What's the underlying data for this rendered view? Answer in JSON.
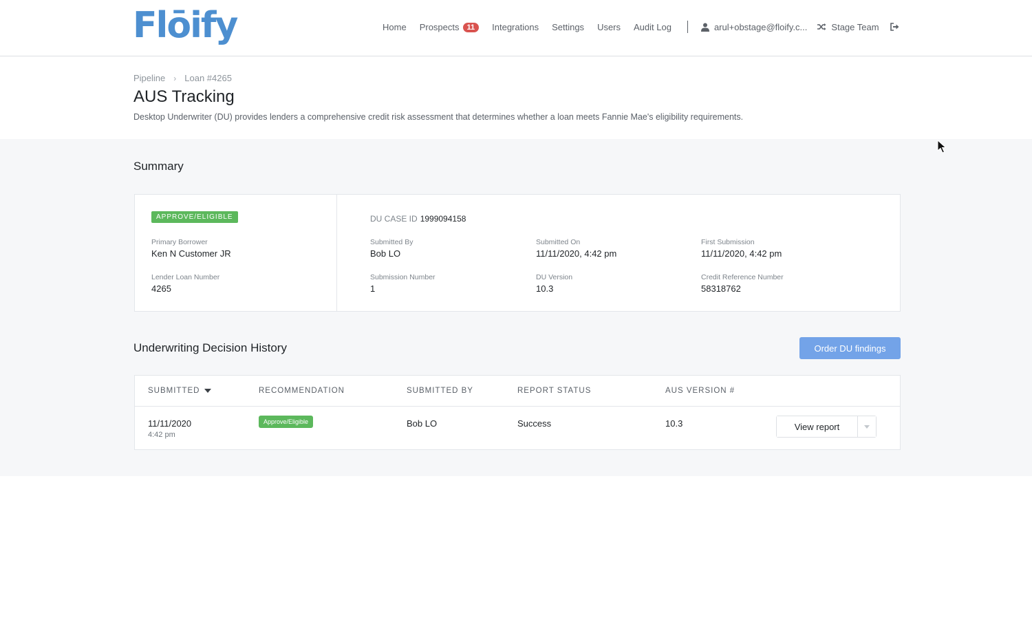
{
  "brand": {
    "logo_text": "Flōify",
    "color": "#4d8fd0"
  },
  "nav": {
    "home": "Home",
    "prospects": "Prospects",
    "prospects_count": "11",
    "integrations": "Integrations",
    "settings": "Settings",
    "users": "Users",
    "audit_log": "Audit Log",
    "user_email": "arul+obstage@floify.c...",
    "team": "Stage Team"
  },
  "breadcrumb": {
    "root": "Pipeline",
    "current": "Loan #4265"
  },
  "page": {
    "title": "AUS Tracking",
    "description": "Desktop Underwriter (DU) provides lenders a comprehensive credit risk assessment that determines whether a loan meets Fannie Mae's eligibility requirements."
  },
  "summary": {
    "section_title": "Summary",
    "status": "APPROVE/ELIGIBLE",
    "primary_borrower_label": "Primary Borrower",
    "primary_borrower": "Ken N Customer JR",
    "lender_loan_number_label": "Lender Loan Number",
    "lender_loan_number": "4265",
    "du_case_id_label": "DU CASE ID",
    "du_case_id": "1999094158",
    "submitted_by_label": "Submitted By",
    "submitted_by": "Bob LO",
    "submitted_on_label": "Submitted On",
    "submitted_on": "11/11/2020, 4:42 pm",
    "first_submission_label": "First Submission",
    "first_submission": "11/11/2020, 4:42 pm",
    "submission_number_label": "Submission Number",
    "submission_number": "1",
    "du_version_label": "DU Version",
    "du_version": "10.3",
    "credit_reference_label": "Credit Reference Number",
    "credit_reference": "58318762"
  },
  "history": {
    "section_title": "Underwriting Decision History",
    "order_button": "Order DU findings",
    "columns": [
      "SUBMITTED",
      "RECOMMENDATION",
      "SUBMITTED BY",
      "REPORT STATUS",
      "AUS VERSION #"
    ],
    "rows": [
      {
        "date": "11/11/2020",
        "time": "4:42 pm",
        "recommendation": "Approve/Eligible",
        "submitted_by": "Bob LO",
        "status": "Success",
        "version": "10.3",
        "action": "View report"
      }
    ]
  },
  "colors": {
    "accent": "#73a3e8",
    "success": "#5cb85c",
    "badge": "#d9534f"
  }
}
